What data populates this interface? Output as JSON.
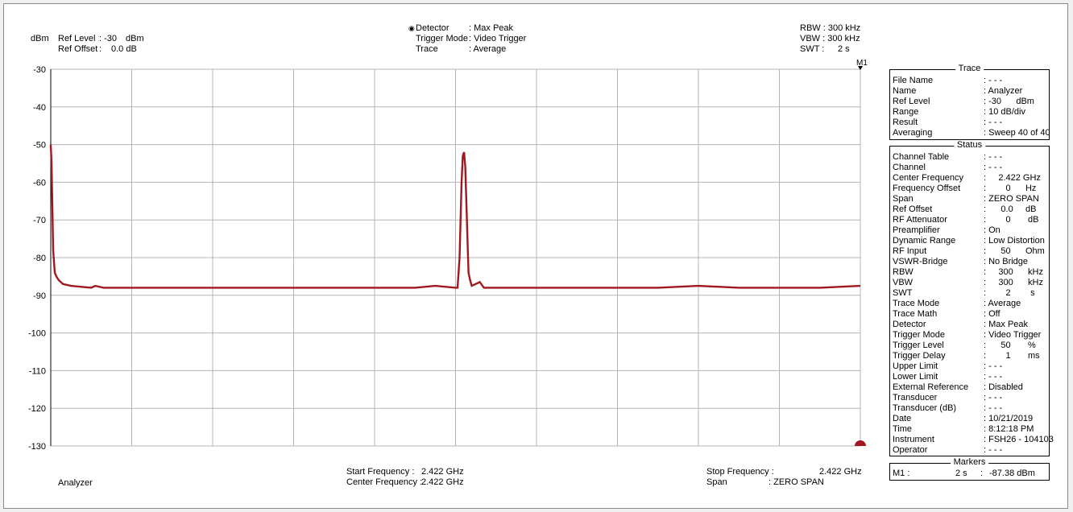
{
  "header": {
    "unit": "dBm",
    "ref_level_label": "Ref Level",
    "ref_level_value": ": -30",
    "ref_level_unit": "dBm",
    "ref_offset_label": "Ref Offset",
    "ref_offset_value": ":",
    "ref_offset_num": "0.0 dB",
    "detector_label": "Detector",
    "detector_value": ": Max Peak",
    "trigger_mode_label": "Trigger Mode",
    "trigger_mode_value": ": Video Trigger",
    "trace_label": "Trace",
    "trace_value": ": Average",
    "rbw": "RBW : 300 kHz",
    "vbw": "VBW : 300 kHz",
    "swt_label": "SWT :",
    "swt_value": "2 s",
    "marker_tag": "M1"
  },
  "footer": {
    "mode": "Analyzer",
    "start_freq_label": "Start Frequency :",
    "start_freq_value": "2.422 GHz",
    "center_freq_label": "Center Frequency :",
    "center_freq_value": "2.422 GHz",
    "stop_freq_label": "Stop Frequency :",
    "stop_freq_value": "2.422 GHz",
    "span_label": "Span",
    "span_value": ": ZERO SPAN"
  },
  "trace_panel": {
    "title": "Trace",
    "rows": [
      {
        "label": "File Name",
        "value": ": - - -"
      },
      {
        "label": "Name",
        "value": ": Analyzer"
      },
      {
        "label": "Ref Level",
        "value": ": -30      dBm"
      },
      {
        "label": "Range",
        "value": ": 10 dB/div"
      },
      {
        "label": "Result",
        "value": ": - - -"
      },
      {
        "label": "Averaging",
        "value": ": Sweep 40 of 40"
      }
    ]
  },
  "status_panel": {
    "title": "Status",
    "rows": [
      {
        "label": "Channel Table",
        "value": ": - - -"
      },
      {
        "label": "Channel",
        "value": ": - - -"
      },
      {
        "label": "Center Frequency",
        "value": ":     2.422 GHz"
      },
      {
        "label": "Frequency Offset",
        "value": ":        0      Hz"
      },
      {
        "label": "Span",
        "value": ": ZERO SPAN"
      },
      {
        "label": "Ref Offset",
        "value": ":      0.0     dB"
      },
      {
        "label": "RF Attenuator",
        "value": ":        0       dB"
      },
      {
        "label": "Preamplifier",
        "value": ": On"
      },
      {
        "label": "Dynamic Range",
        "value": ": Low Distortion"
      },
      {
        "label": "RF Input",
        "value": ":      50      Ohm"
      },
      {
        "label": "VSWR-Bridge",
        "value": ": No Bridge"
      },
      {
        "label": "RBW",
        "value": ":     300      kHz"
      },
      {
        "label": "VBW",
        "value": ":     300      kHz"
      },
      {
        "label": "SWT",
        "value": ":        2        s"
      },
      {
        "label": "Trace Mode",
        "value": ": Average"
      },
      {
        "label": "Trace Math",
        "value": ": Off"
      },
      {
        "label": "Detector",
        "value": ": Max Peak"
      },
      {
        "label": "Trigger Mode",
        "value": ": Video Trigger"
      },
      {
        "label": "Trigger Level",
        "value": ":      50       %"
      },
      {
        "label": "Trigger Delay",
        "value": ":        1       ms"
      },
      {
        "label": "Upper Limit",
        "value": ": - - -"
      },
      {
        "label": "Lower Limit",
        "value": ": - - -"
      },
      {
        "label": "External Reference",
        "value": ": Disabled"
      },
      {
        "label": "Transducer",
        "value": ": - - -"
      },
      {
        "label": "Transducer (dB)",
        "value": ": - - -"
      },
      {
        "label": "Date",
        "value": ": 10/21/2019"
      },
      {
        "label": "Time",
        "value": ": 8:12:18 PM"
      },
      {
        "label": "Instrument",
        "value": ": FSH26 - 104103"
      },
      {
        "label": "Operator",
        "value": ": - - -"
      }
    ]
  },
  "markers_panel": {
    "title": "Markers",
    "m1_label": "M1 :",
    "m1_time": "2 s",
    "m1_sep": ":",
    "m1_value": "-87.38 dBm"
  },
  "colors": {
    "trace": "#a01820",
    "grid": "#b4b4b4"
  },
  "chart_data": {
    "type": "line",
    "xlabel": "",
    "ylabel": "dBm",
    "xlim": [
      0,
      2
    ],
    "ylim": [
      -130,
      -30
    ],
    "yticks": [
      -30,
      -40,
      -50,
      -60,
      -70,
      -80,
      -90,
      -100,
      -110,
      -120,
      -130
    ],
    "grid": true,
    "series": [
      {
        "x": [
          0,
          0.002,
          0.006,
          0.01,
          0.014,
          0.02,
          0.03,
          0.05,
          0.1,
          0.11,
          0.13,
          0.2,
          0.3,
          0.4,
          0.5,
          0.6,
          0.7,
          0.8,
          0.9,
          0.95,
          1.0,
          1.005,
          1.01,
          1.015,
          1.018,
          1.021,
          1.024,
          1.028,
          1.032,
          1.036,
          1.04,
          1.06,
          1.07,
          1.1,
          1.2,
          1.3,
          1.4,
          1.5,
          1.6,
          1.7,
          1.8,
          1.9,
          2.0
        ],
        "y": [
          -50,
          -55,
          -78,
          -84,
          -85,
          -86,
          -87,
          -87.5,
          -88,
          -87.5,
          -88,
          -88,
          -88,
          -88,
          -88,
          -88,
          -88,
          -88,
          -88,
          -87.5,
          -88,
          -88,
          -80,
          -60,
          -53,
          -52,
          -56,
          -70,
          -84,
          -86,
          -87.5,
          -86.5,
          -88,
          -88,
          -88,
          -88,
          -88,
          -88,
          -87.5,
          -88,
          -88,
          -88,
          -87.5
        ]
      }
    ],
    "marker": {
      "name": "M1",
      "x": 2,
      "y": -87.38
    }
  }
}
